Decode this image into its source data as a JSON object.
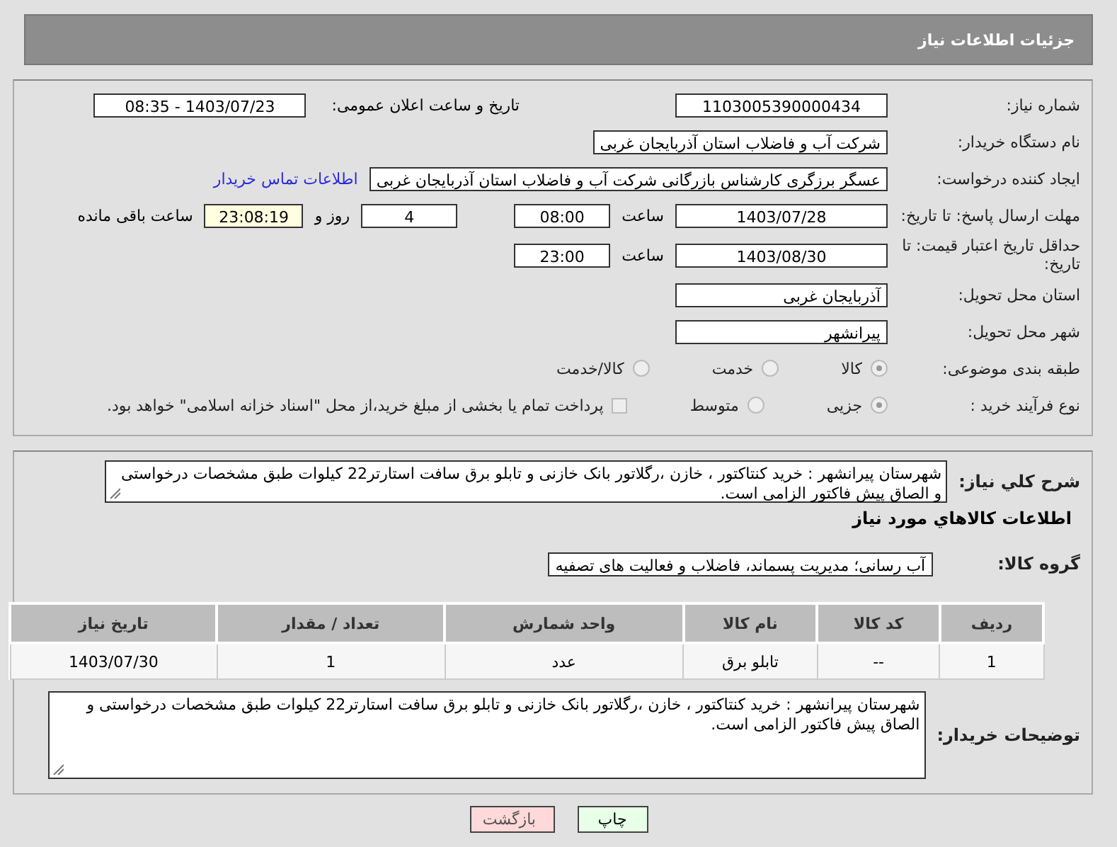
{
  "header": {
    "title": "جزئیات اطلاعات نیاز"
  },
  "need_number": {
    "label": "شماره نیاز:",
    "value": "1103005390000434"
  },
  "announce": {
    "label": "تاریخ و ساعت اعلان عمومی:",
    "value": "1403/07/23 - 08:35"
  },
  "buyer": {
    "label": "نام دستگاه خریدار:",
    "value": "شرکت آب و فاضلاب استان آذربایجان غربی"
  },
  "creator": {
    "label": "ایجاد کننده درخواست:",
    "value": "عسگر  برزگری کارشناس بازرگانی شرکت آب و فاضلاب استان آذربایجان غربی",
    "link": "اطلاعات تماس خریدار"
  },
  "deadline": {
    "label": "مهلت ارسال پاسخ: تا تاریخ:",
    "date": "1403/07/28",
    "time_label": "ساعت",
    "time": "08:00",
    "days": "4",
    "days_label": "روز و",
    "remaining": "23:08:19",
    "remaining_label": "ساعت باقی مانده"
  },
  "validity": {
    "label": "حداقل تاریخ اعتبار قیمت: تا تاریخ:",
    "date": "1403/08/30",
    "time_label": "ساعت",
    "time": "23:00"
  },
  "province": {
    "label": "استان محل تحویل:",
    "value": "آذربایجان غربی"
  },
  "city": {
    "label": "شهر محل تحویل:",
    "value": "پیرانشهر"
  },
  "category": {
    "label": "طبقه بندی موضوعی:",
    "options": [
      {
        "label": "کالا",
        "selected": true
      },
      {
        "label": "خدمت",
        "selected": false
      },
      {
        "label": "کالا/خدمت",
        "selected": false
      }
    ]
  },
  "process": {
    "label": "نوع فرآیند خرید :",
    "options": [
      {
        "label": "جزیی",
        "selected": true
      },
      {
        "label": "متوسط",
        "selected": false
      }
    ],
    "payment": {
      "label": "پرداخت تمام یا بخشی از مبلغ خرید،از محل \"اسناد خزانه اسلامی\" خواهد بود.",
      "checked": false
    }
  },
  "description": {
    "label": "شرح کلي نياز:",
    "value": "شهرستان پیرانشهر :  خرید کنتاکتور ، خازن ،رگلاتور بانک خازنی و تابلو برق سافت استارتر22 کیلوات طبق مشخصات درخواستی و الصاق پیش فاکتور الزامی است."
  },
  "goods_heading": "اطلاعات کالاهاي مورد نياز",
  "goods_group": {
    "label": "گروه کالا:",
    "value": "آب رسانی؛ مدیریت پسماند، فاضلاب و فعالیت های تصفیه"
  },
  "table": {
    "columns": [
      "ردیف",
      "کد کالا",
      "نام کالا",
      "واحد شمارش",
      "تعداد / مقدار",
      "تاریخ نیاز"
    ],
    "rows": [
      [
        "1",
        "--",
        "تابلو برق",
        "عدد",
        "1",
        "1403/07/30"
      ]
    ]
  },
  "buyer_notes": {
    "label": "توضیحات خریدار:",
    "value": "شهرستان پیرانشهر :  خرید کنتاکتور ، خازن ،رگلاتور بانک خازنی و تابلو برق سافت استارتر22 کیلوات طبق مشخصات درخواستی و الصاق پیش فاکتور الزامی است."
  },
  "buttons": [
    {
      "label": "چاپ",
      "kind": "print"
    },
    {
      "label": "بازگشت",
      "kind": "back"
    }
  ]
}
